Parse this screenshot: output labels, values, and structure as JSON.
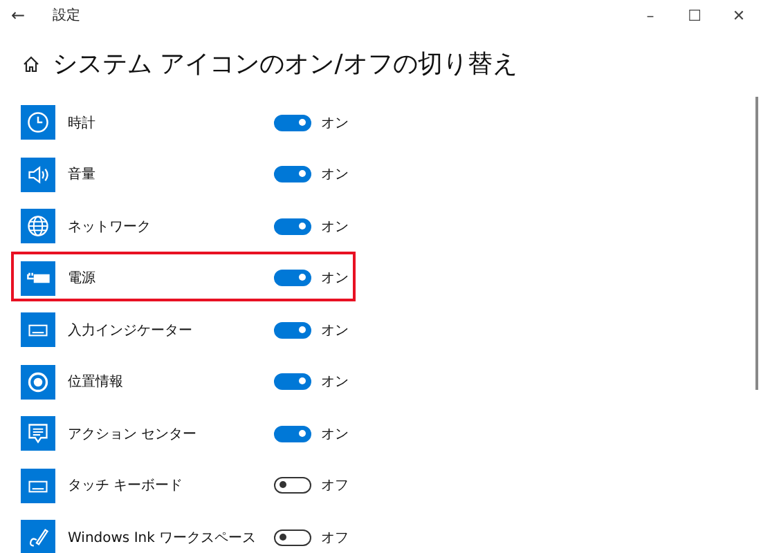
{
  "window": {
    "title": "設定",
    "back": "←",
    "controls": [
      "–",
      "☐",
      "✕"
    ]
  },
  "heading": "システム アイコンのオン/オフの切り替え",
  "items": [
    {
      "label": "時計",
      "on": true,
      "state_text": "オン",
      "highlighted": false
    },
    {
      "label": "音量",
      "on": true,
      "state_text": "オン",
      "highlighted": false
    },
    {
      "label": "ネットワーク",
      "on": true,
      "state_text": "オン",
      "highlighted": false
    },
    {
      "label": "電源",
      "on": true,
      "state_text": "オン",
      "highlighted": true
    },
    {
      "label": "入力インジケーター",
      "on": true,
      "state_text": "オン",
      "highlighted": false
    },
    {
      "label": "位置情報",
      "on": true,
      "state_text": "オン",
      "highlighted": false
    },
    {
      "label": "アクション センター",
      "on": true,
      "state_text": "オン",
      "highlighted": false
    },
    {
      "label": "タッチ キーボード",
      "on": false,
      "state_text": "オフ",
      "highlighted": false
    },
    {
      "label": "Windows Ink ワークスペース",
      "on": false,
      "state_text": "オフ",
      "highlighted": false
    }
  ]
}
